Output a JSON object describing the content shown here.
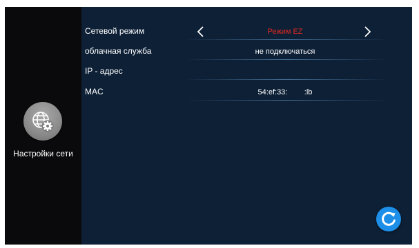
{
  "sidebar": {
    "icon": "globe-gear-icon",
    "label": "Настройки сети"
  },
  "rows": [
    {
      "label": "Сетевой режим",
      "value": "Режим EZ",
      "value_color": "#e0281e"
    },
    {
      "label": "облачная служба",
      "value": "не подключаться"
    },
    {
      "label": "IP - адрес",
      "value": ""
    },
    {
      "label": "MAC",
      "value": "54:ef:33:        :lb"
    }
  ],
  "icons": {
    "prev": "chevron-left-icon",
    "next": "chevron-right-icon",
    "refresh": "refresh-icon"
  },
  "colors": {
    "background": "#0d2036",
    "sidebar": "#0a0a0c",
    "accent": "#1e8fe8",
    "highlight": "#e0281e"
  }
}
